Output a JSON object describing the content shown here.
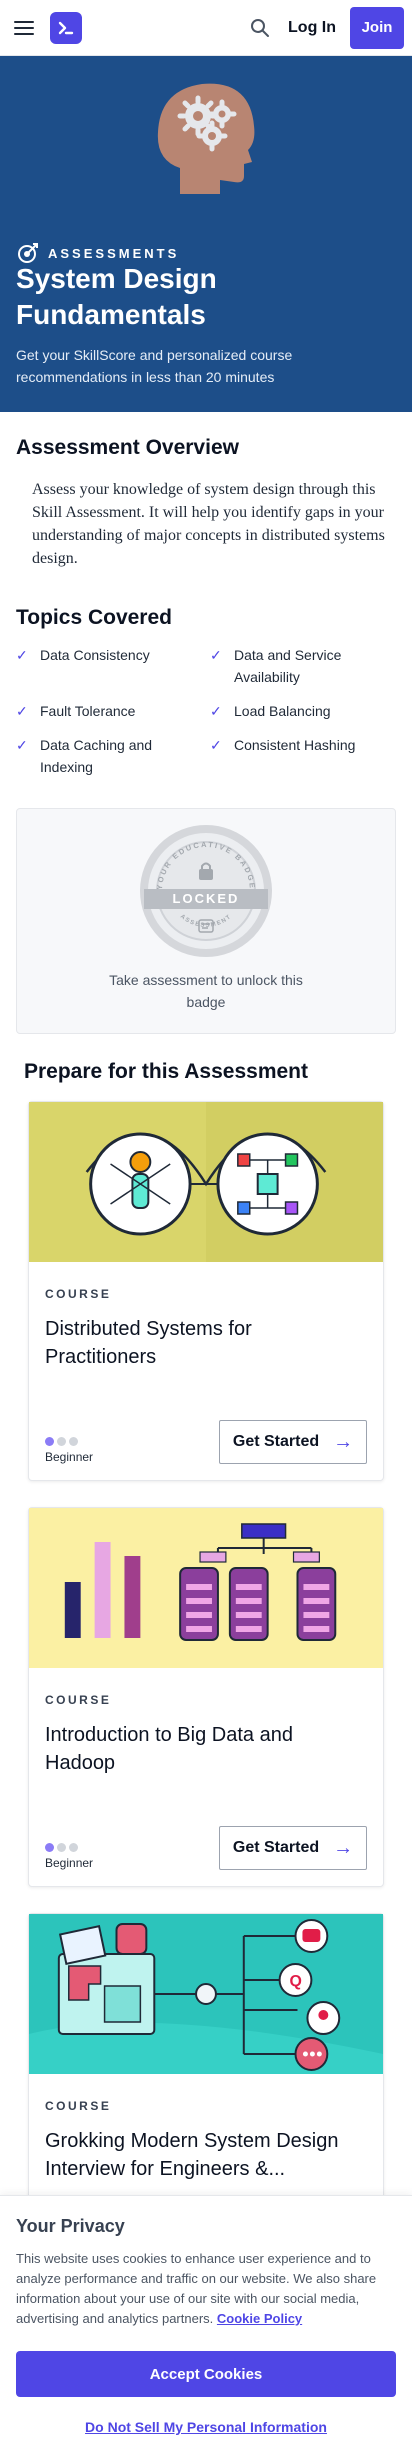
{
  "header": {
    "login_label": "Log In",
    "join_label": "Join",
    "accent_color": "#4f46e5"
  },
  "hero": {
    "tag": "ASSESSMENTS",
    "title": "System Design Fundamentals",
    "subtitle": "Get your SkillScore and personalized course recommendations in less than 20 minutes",
    "background": "#1d4e89"
  },
  "overview": {
    "heading": "Assessment Overview",
    "body": "Assess your knowledge of system design through this Skill Assessment. It will help you identify gaps in your understanding of major concepts in distributed systems design."
  },
  "topics": {
    "heading": "Topics Covered",
    "items": [
      "Data Consistency",
      "Data and Service Availability",
      "Fault Tolerance",
      "Load Balancing",
      "Data Caching and Indexing",
      "Consistent Hashing"
    ]
  },
  "badge": {
    "ring_text_top": "YOUR EDUCATIVE BADGE",
    "ring_text_bottom": "ASSESSMENT",
    "locked_label": "LOCKED",
    "caption": "Take assessment to unlock this badge"
  },
  "prepare": {
    "heading": "Prepare for this Assessment",
    "courses": [
      {
        "type": "COURSE",
        "title": "Distributed Systems for Practitioners",
        "level": "Beginner",
        "level_dots": 1,
        "cta": "Get Started"
      },
      {
        "type": "COURSE",
        "title": "Introduction to Big Data and Hadoop",
        "level": "Beginner",
        "level_dots": 1,
        "cta": "Get Started"
      },
      {
        "type": "COURSE",
        "title": "Grokking Modern System Design Interview for Engineers &...",
        "level": "",
        "level_dots": 0,
        "cta": ""
      }
    ]
  },
  "privacy": {
    "heading": "Your Privacy",
    "body": "This website uses cookies to enhance user experience and to analyze performance and traffic on our website. We also share information about your use of our site with our social media, advertising and analytics partners.",
    "policy_link": "Cookie Policy",
    "accept_label": "Accept Cookies",
    "dnsmpi_label": "Do Not Sell My Personal Information"
  }
}
